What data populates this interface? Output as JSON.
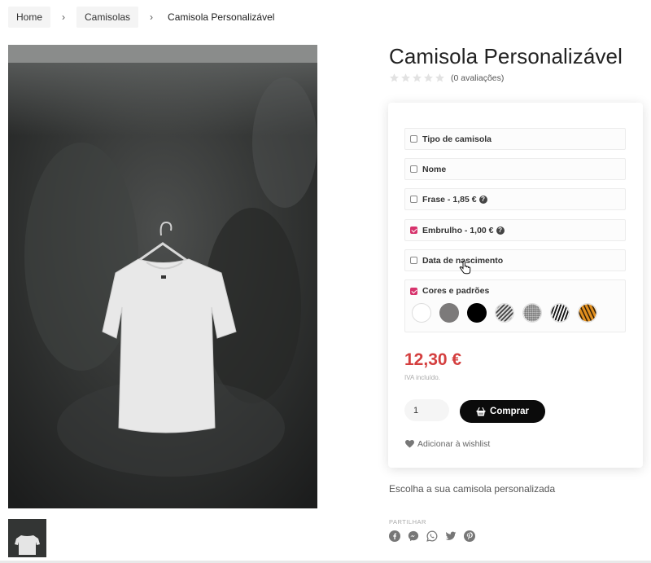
{
  "breadcrumb": {
    "home": "Home",
    "category": "Camisolas",
    "current": "Camisola Personalizável",
    "separator": "›"
  },
  "product": {
    "title": "Camisola Personalizável",
    "reviews": "(0 avaliações)",
    "rating_stars": 0,
    "rating_max": 5,
    "description": "Escolha a sua camisola personalizada"
  },
  "options": [
    {
      "label": "Tipo de camisola",
      "checked": false,
      "help": false
    },
    {
      "label": "Nome",
      "checked": false,
      "help": false
    },
    {
      "label": "Frase - 1,85 €",
      "checked": false,
      "help": true
    },
    {
      "label": "Embrulho - 1,00 €",
      "checked": true,
      "help": true
    },
    {
      "label": "Data de nascimento",
      "checked": false,
      "help": false
    }
  ],
  "colors": {
    "label": "Cores e padrões",
    "checked": true,
    "swatches": [
      {
        "name": "branco",
        "color": "#ffffff"
      },
      {
        "name": "cinzento",
        "color": "#7c7a7a"
      },
      {
        "name": "preto",
        "color": "#000000"
      },
      {
        "name": "padrão-xadrez-escuro",
        "color": "#6a6a6a"
      },
      {
        "name": "padrão-xadrez-claro",
        "color": "#9a9a9a"
      },
      {
        "name": "padrão-zebra",
        "color": "#222222"
      },
      {
        "name": "padrão-tigre",
        "color": "#d9891b"
      }
    ]
  },
  "price": {
    "value": "12,30 €",
    "tax_note": "IVA incluído.",
    "color": "#d43f3f"
  },
  "cart": {
    "quantity": "1",
    "buy_label": "Comprar"
  },
  "wishlist": {
    "label": "Adicionar à wishlist"
  },
  "share": {
    "label": "PARTILHAR",
    "icons": [
      "facebook-icon",
      "messenger-icon",
      "whatsapp-icon",
      "twitter-icon",
      "pinterest-icon"
    ]
  }
}
